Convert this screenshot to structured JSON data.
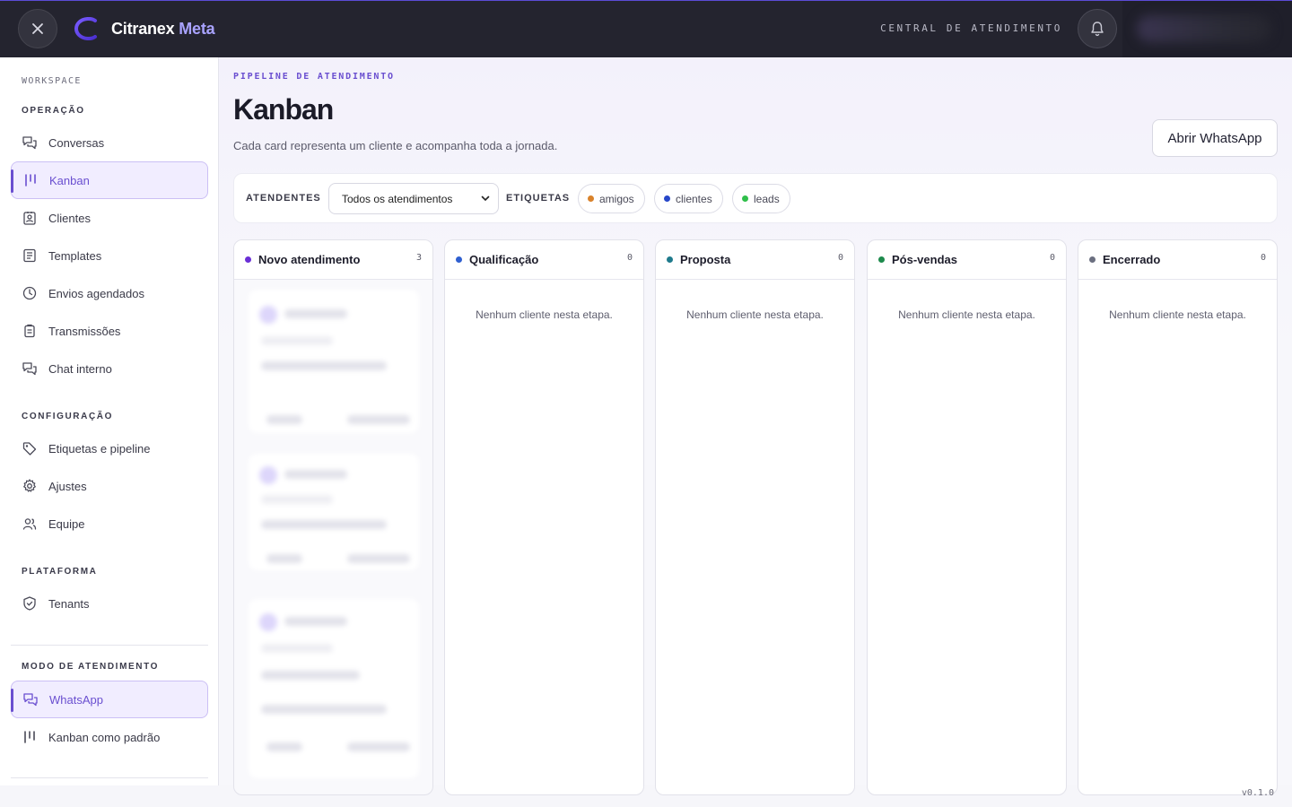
{
  "topbar": {
    "brand_name": "Citranex",
    "brand_accent": "Meta",
    "central_label": "CENTRAL DE ATENDIMENTO",
    "close_icon": "close-icon",
    "bell_icon": "bell-icon"
  },
  "sidebar": {
    "workspace_label": "WORKSPACE",
    "sections": {
      "operacao": "OPERAÇÃO",
      "configuracao": "CONFIGURAÇÃO",
      "plataforma": "PLATAFORMA",
      "modo": "MODO DE ATENDIMENTO"
    },
    "items": {
      "conversas": "Conversas",
      "kanban": "Kanban",
      "clientes": "Clientes",
      "templates": "Templates",
      "envios": "Envios agendados",
      "transmissoes": "Transmissões",
      "chat_interno": "Chat interno",
      "etiquetas": "Etiquetas e pipeline",
      "ajustes": "Ajustes",
      "equipe": "Equipe",
      "tenants": "Tenants",
      "whatsapp": "WhatsApp",
      "kanban_padrao": "Kanban como padrão"
    },
    "active_item": "kanban",
    "active_mode": "whatsapp"
  },
  "main": {
    "eyebrow": "PIPELINE DE ATENDIMENTO",
    "title": "Kanban",
    "subtitle": "Cada card representa um cliente e acompanha toda a jornada.",
    "open_whatsapp": "Abrir WhatsApp"
  },
  "filters": {
    "atendentes_label": "ATENDENTES",
    "atendentes_value": "Todos os atendimentos",
    "etiquetas_label": "ETIQUETAS",
    "tags": [
      {
        "label": "amigos",
        "color": "#d9822b"
      },
      {
        "label": "clientes",
        "color": "#2747c9"
      },
      {
        "label": "leads",
        "color": "#2fbf4a"
      }
    ]
  },
  "columns": [
    {
      "title": "Novo atendimento",
      "count": "3",
      "color": "#6a2fd6",
      "empty": ""
    },
    {
      "title": "Qualificação",
      "count": "0",
      "color": "#2f5fd0",
      "empty": "Nenhum cliente nesta etapa."
    },
    {
      "title": "Proposta",
      "count": "0",
      "color": "#1f7a8c",
      "empty": "Nenhum cliente nesta etapa."
    },
    {
      "title": "Pós-vendas",
      "count": "0",
      "color": "#1d8a4c",
      "empty": "Nenhum cliente nesta etapa."
    },
    {
      "title": "Encerrado",
      "count": "0",
      "color": "#6b6f80",
      "empty": "Nenhum cliente nesta etapa."
    }
  ],
  "version": "v0.1.0"
}
